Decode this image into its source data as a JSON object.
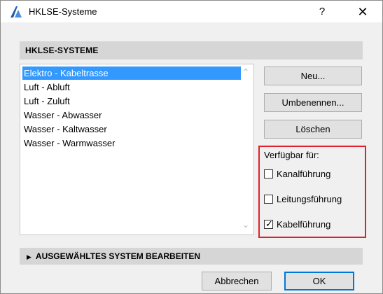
{
  "window": {
    "title": "HKLSE-Systeme",
    "help_label": "?",
    "close_label": "✕"
  },
  "section": {
    "header": "HKLSE-SYSTEME"
  },
  "systems": {
    "items": [
      {
        "label": "Elektro - Kabeltrasse",
        "selected": true
      },
      {
        "label": "Luft - Abluft"
      },
      {
        "label": "Luft - Zuluft"
      },
      {
        "label": "Wasser - Abwasser"
      },
      {
        "label": "Wasser - Kaltwasser"
      },
      {
        "label": "Wasser - Warmwasser"
      }
    ],
    "scroll_up": "⌃",
    "scroll_down": "⌄"
  },
  "actions": {
    "new": "Neu...",
    "rename": "Umbenennen...",
    "delete": "Löschen"
  },
  "availability": {
    "label": "Verfügbar für:",
    "options": [
      {
        "label": "Kanalführung",
        "checked": false
      },
      {
        "label": "Leitungsführung",
        "checked": false
      },
      {
        "label": "Kabelführung",
        "checked": true
      }
    ],
    "check_mark": "✓"
  },
  "edit_section": {
    "arrow": "▶",
    "label": "AUSGEWÄHLTES SYSTEM BEARBEITEN"
  },
  "footer": {
    "cancel": "Abbrechen",
    "ok": "OK"
  },
  "colors": {
    "selection": "#3399ff",
    "highlight_border": "#e0202e",
    "default_button_border": "#0078d7"
  }
}
